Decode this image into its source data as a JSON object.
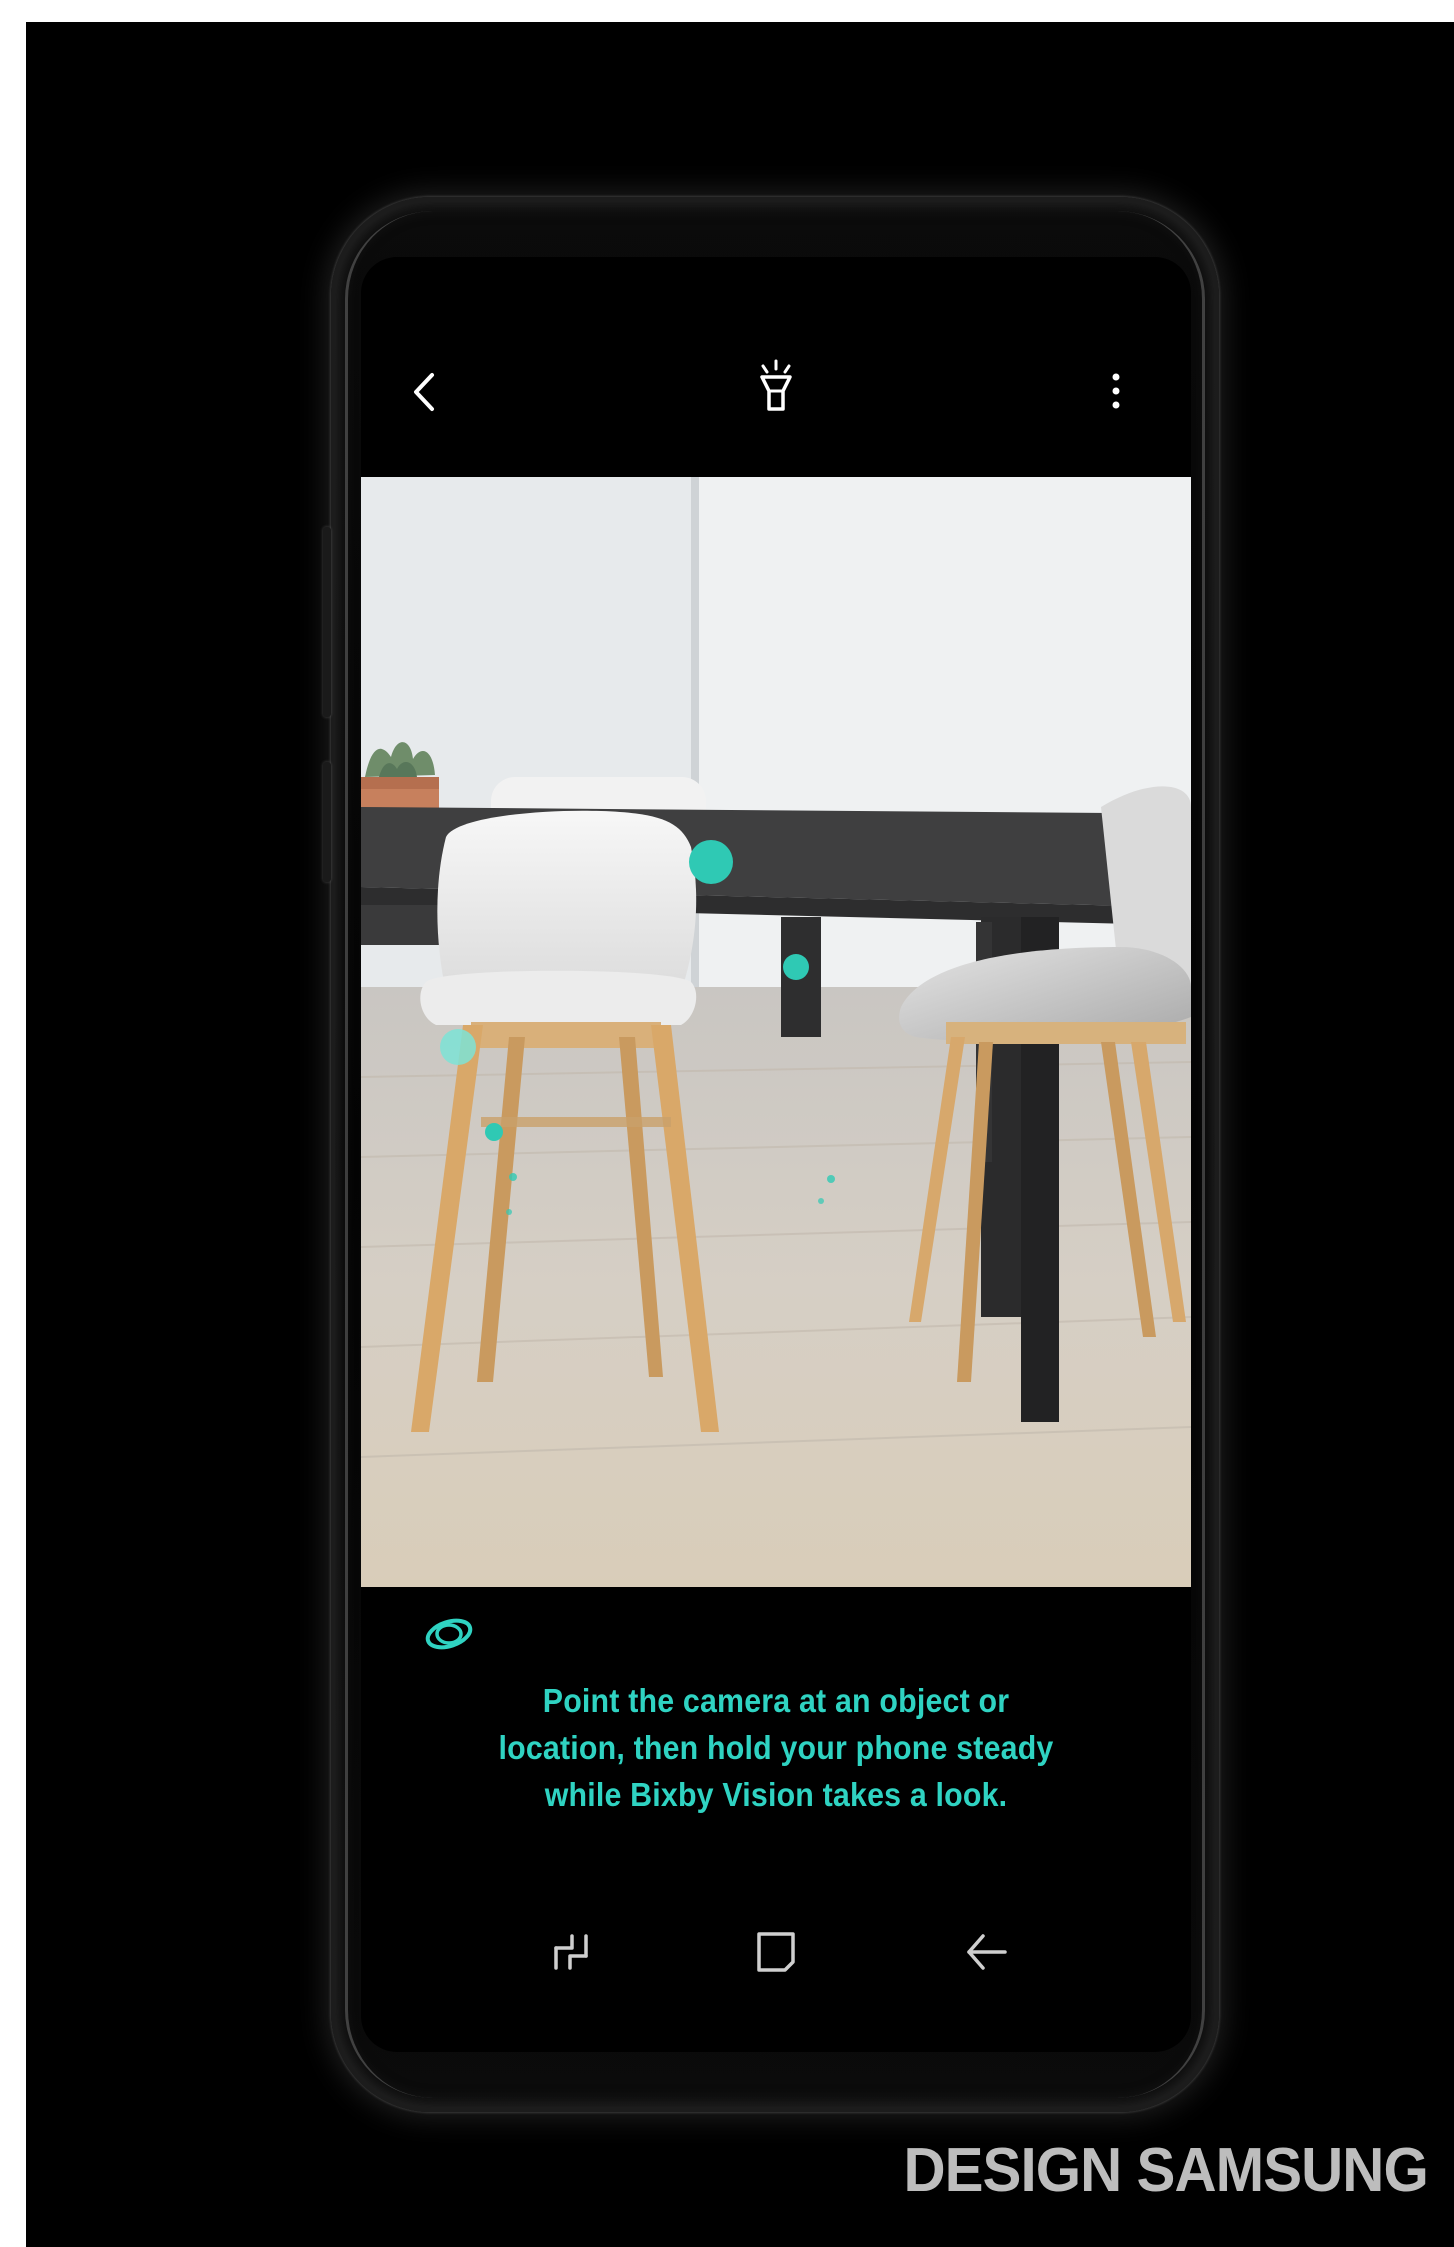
{
  "app": {
    "name": "Bixby Vision",
    "accent_color": "#2fd3c2"
  },
  "top_bar": {
    "icons": [
      "back-icon",
      "flashlight-icon",
      "more-options-icon"
    ]
  },
  "bottom_panel": {
    "mode_icon": "bixby-vision-icon",
    "instruction_lines": [
      "Point the camera at an object or",
      "location, then hold your phone steady",
      "while Bixby Vision takes a look."
    ]
  },
  "nav_bar": {
    "icons": [
      "recent-apps-icon",
      "home-icon",
      "back-nav-icon"
    ]
  },
  "branding": {
    "label": "DESIGN SAMSUNG"
  }
}
